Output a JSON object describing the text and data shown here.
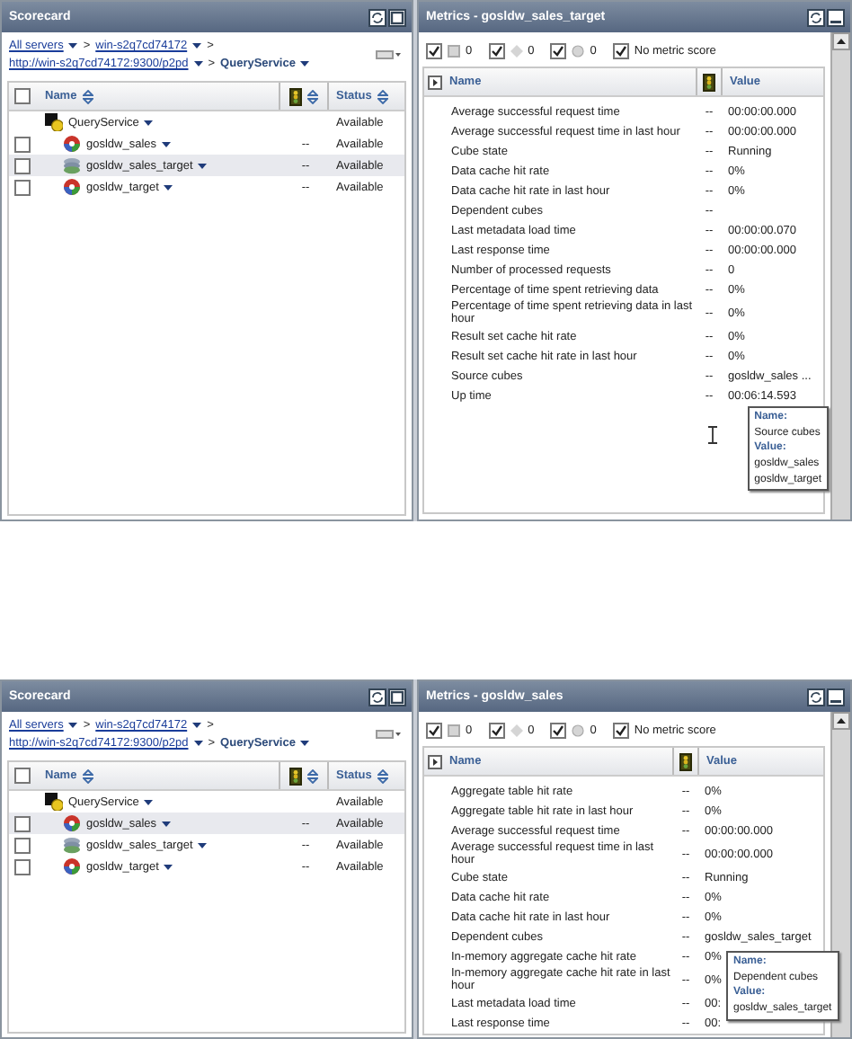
{
  "screenshots": [
    {
      "scorecard": {
        "title": "Scorecard",
        "breadcrumb_lines": [
          [
            {
              "label": "All servers",
              "link": true
            },
            {
              "separator": ">",
              "label": "win-s2q7cd74172",
              "link": true
            },
            {
              "separator": ">"
            }
          ],
          [
            {
              "label": "http://win-s2q7cd74172:9300/p2pd",
              "link": true
            },
            {
              "separator": ">",
              "label": "QueryService",
              "link": false
            }
          ]
        ],
        "select_all": {
          "checked": false
        },
        "columns": {
          "name": "Name",
          "status": "Status"
        },
        "rows": [
          {
            "name": "QueryService",
            "kind": "service",
            "status": "Available",
            "selected": false,
            "children": [
              {
                "name": "gosldw_sales",
                "kind": "cube",
                "indicator": "--",
                "status": "Available",
                "checked": false,
                "selected": false
              },
              {
                "name": "gosldw_sales_target",
                "kind": "virtual-cube",
                "indicator": "--",
                "status": "Available",
                "checked": false,
                "selected": true
              },
              {
                "name": "gosldw_target",
                "kind": "cube",
                "indicator": "--",
                "status": "Available",
                "checked": false,
                "selected": false
              }
            ]
          }
        ]
      },
      "metrics": {
        "title": "Metrics - gosldw_sales_target",
        "text_cursor": true,
        "filters": [
          {
            "kind": "square",
            "label": "0",
            "checked": true
          },
          {
            "kind": "diamond",
            "label": "0",
            "checked": true
          },
          {
            "kind": "circle",
            "label": "0",
            "checked": true
          },
          {
            "kind": "none",
            "label": "No metric score",
            "checked": true
          }
        ],
        "columns": {
          "name": "Name",
          "value": "Value"
        },
        "rows": [
          {
            "name": "Average successful request time",
            "indicator": "--",
            "value": "00:00:00.000"
          },
          {
            "name": "Average successful request time in last hour",
            "indicator": "--",
            "value": "00:00:00.000"
          },
          {
            "name": "Cube state",
            "indicator": "--",
            "value": "Running"
          },
          {
            "name": "Data cache hit rate",
            "indicator": "--",
            "value": "0%"
          },
          {
            "name": "Data cache hit rate in last hour",
            "indicator": "--",
            "value": "0%"
          },
          {
            "name": "Dependent cubes",
            "indicator": "--"
          },
          {
            "name": "Last metadata load time",
            "indicator": "--",
            "value": "00:00:00.070"
          },
          {
            "name": "Last response time",
            "indicator": "--",
            "value": "00:00:00.000"
          },
          {
            "name": "Number of processed requests",
            "indicator": "--",
            "value": "0"
          },
          {
            "name": "Percentage of time spent retrieving data",
            "indicator": "--",
            "value": "0%"
          },
          {
            "name": "Percentage of time spent retrieving data in last hour",
            "indicator": "--",
            "value": "0%"
          },
          {
            "name": "Result set cache hit rate",
            "indicator": "--",
            "value": "0%"
          },
          {
            "name": "Result set cache hit rate in last hour",
            "indicator": "--",
            "value": "0%"
          },
          {
            "name": "Source cubes",
            "indicator": "--",
            "value": "gosldw_sales ..."
          },
          {
            "name": "Up time",
            "indicator": "--",
            "value": "00:06:14.593"
          }
        ],
        "tooltip": {
          "name_label": "Name:",
          "name": "Source cubes",
          "value_label": "Value:",
          "values": [
            "gosldw_sales",
            "gosldw_target"
          ]
        }
      }
    },
    {
      "scorecard": {
        "title": "Scorecard",
        "breadcrumb_lines": [
          [
            {
              "label": "All servers",
              "link": true
            },
            {
              "separator": ">",
              "label": "win-s2q7cd74172",
              "link": true
            },
            {
              "separator": ">"
            }
          ],
          [
            {
              "label": "http://win-s2q7cd74172:9300/p2pd",
              "link": true
            },
            {
              "separator": ">",
              "label": "QueryService",
              "link": false
            }
          ]
        ],
        "select_all": {
          "checked": false
        },
        "columns": {
          "name": "Name",
          "status": "Status"
        },
        "rows": [
          {
            "name": "QueryService",
            "kind": "service",
            "status": "Available",
            "selected": false,
            "children": [
              {
                "name": "gosldw_sales",
                "kind": "cube",
                "indicator": "--",
                "status": "Available",
                "checked": false,
                "selected": true
              },
              {
                "name": "gosldw_sales_target",
                "kind": "virtual-cube",
                "indicator": "--",
                "status": "Available",
                "checked": false,
                "selected": false
              },
              {
                "name": "gosldw_target",
                "kind": "cube",
                "indicator": "--",
                "status": "Available",
                "checked": false,
                "selected": false
              }
            ]
          }
        ]
      },
      "metrics": {
        "title": "Metrics - gosldw_sales",
        "text_cursor": false,
        "filters": [
          {
            "kind": "square",
            "label": "0",
            "checked": true
          },
          {
            "kind": "diamond",
            "label": "0",
            "checked": true
          },
          {
            "kind": "circle",
            "label": "0",
            "checked": true
          },
          {
            "kind": "none",
            "label": "No metric score",
            "checked": true
          }
        ],
        "columns": {
          "name": "Name",
          "value": "Value"
        },
        "rows": [
          {
            "name": "Aggregate table hit rate",
            "indicator": "--",
            "value": "0%"
          },
          {
            "name": "Aggregate table hit rate in last hour",
            "indicator": "--",
            "value": "0%"
          },
          {
            "name": "Average successful request time",
            "indicator": "--",
            "value": "00:00:00.000"
          },
          {
            "name": "Average successful request time in last hour",
            "indicator": "--",
            "value": "00:00:00.000"
          },
          {
            "name": "Cube state",
            "indicator": "--",
            "value": "Running"
          },
          {
            "name": "Data cache hit rate",
            "indicator": "--",
            "value": "0%"
          },
          {
            "name": "Data cache hit rate in last hour",
            "indicator": "--",
            "value": "0%"
          },
          {
            "name": "Dependent cubes",
            "indicator": "--",
            "value": "gosldw_sales_target"
          },
          {
            "name": "In-memory aggregate cache hit rate",
            "indicator": "--",
            "value": "0%"
          },
          {
            "name": "In-memory aggregate cache hit rate in last hour",
            "indicator": "--",
            "value": "0%"
          },
          {
            "name": "Last metadata load time",
            "indicator": "--",
            "value": "00:"
          },
          {
            "name": "Last response time",
            "indicator": "--",
            "value": "00:"
          }
        ],
        "tooltip": {
          "name_label": "Name:",
          "name": "Dependent cubes",
          "value_label": "Value:",
          "values": [
            "gosldw_sales_target"
          ]
        }
      }
    }
  ]
}
